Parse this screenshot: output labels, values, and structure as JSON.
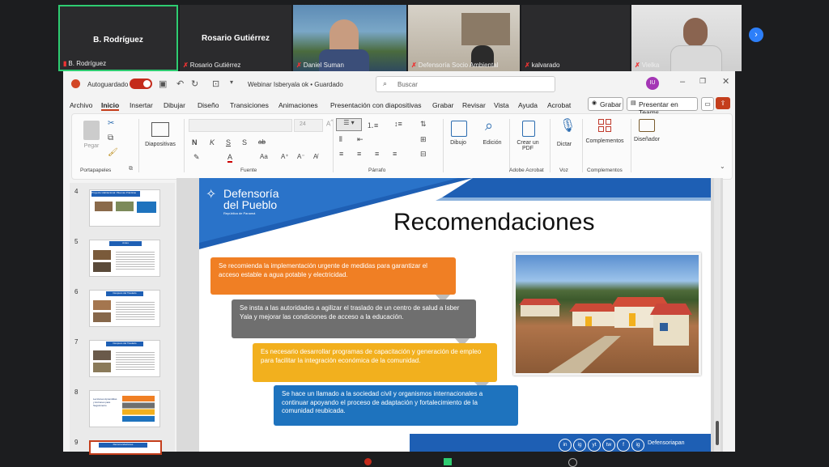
{
  "participants": {
    "tile1_name": "B. Rodríguez",
    "tile1_caption": "B. Rodríguez",
    "tile2_name": "Rosario Gutiérrez",
    "tile2_caption": "Rosario Gutiérrez",
    "tile3_caption": "Daniel Suman",
    "tile4_caption": "Defensoría Socio Ambiental",
    "tile5_caption": "kalvarado",
    "tile6_caption": "Vielka"
  },
  "titlebar": {
    "autosave": "Autoguardado",
    "doc_title": "Webinar Isberyala ok • Guardado",
    "search_placeholder": "Buscar",
    "avatar": "IU"
  },
  "tabs": [
    "Archivo",
    "Inicio",
    "Insertar",
    "Dibujar",
    "Diseño",
    "Transiciones",
    "Animaciones",
    "Presentación con diapositivas",
    "Grabar",
    "Revisar",
    "Vista",
    "Ayuda",
    "Acrobat"
  ],
  "tab_buttons": {
    "record": "Grabar",
    "present_teams": "Presentar en Teams"
  },
  "ribbon": {
    "paste": "Pegar",
    "slides": "Diapositivas",
    "font_size": "24",
    "draw": "Dibujo",
    "edit": "Edición",
    "create_pdf": "Crear un PDF",
    "dictate": "Dictar",
    "addins": "Complementos",
    "designer": "Diseñador",
    "group_clipboard": "Portapapeles",
    "group_font": "Fuente",
    "group_paragraph": "Párrafo",
    "group_acrobat": "Adobe Acrobat",
    "group_voice": "Voz",
    "group_addins": "Complementos",
    "font_letters": [
      "N",
      "K",
      "S",
      "S",
      "ab"
    ]
  },
  "thumbnails": [
    {
      "num": "4",
      "title": "Proyecto Habitacional / Buenas Prácticas"
    },
    {
      "num": "5",
      "title": "Antes"
    },
    {
      "num": "6",
      "title": "Después del Traslado"
    },
    {
      "num": "7",
      "title": "Después del Traslado"
    },
    {
      "num": "8",
      "title": "Lecciones Aprendidas y Acciones para Seguimiento"
    },
    {
      "num": "9",
      "title": "Recomendaciones"
    }
  ],
  "slide": {
    "logo_line1": "Defensoría",
    "logo_line2": "del Pueblo",
    "logo_sub": "República de Panamá",
    "title": "Recomendaciones",
    "boxes": [
      {
        "text": "Se recomienda la implementación urgente de medidas para garantizar el acceso estable a agua potable y electricidad.",
        "color": "#f07f24"
      },
      {
        "text": "Se insta a las autoridades a agilizar el traslado de un centro de salud a Isber Yala y mejorar las condiciones de acceso a la educación.",
        "color": "#6f6f6f"
      },
      {
        "text": "Es necesario desarrollar programas de capacitación y generación de empleo para facilitar la integración económica de la comunidad.",
        "color": "#f2b01e"
      },
      {
        "text": "Se hace un llamado a la sociedad civil y organismos internacionales a continuar apoyando el proceso de adaptación y fortalecimiento de la comunidad reubicada.",
        "color": "#1e73be"
      }
    ],
    "social_handle": "Defensoriapan",
    "social_icons": [
      "in",
      "ig",
      "yt",
      "tw",
      "f",
      "ig"
    ],
    "accent": "#1e5fb4"
  }
}
